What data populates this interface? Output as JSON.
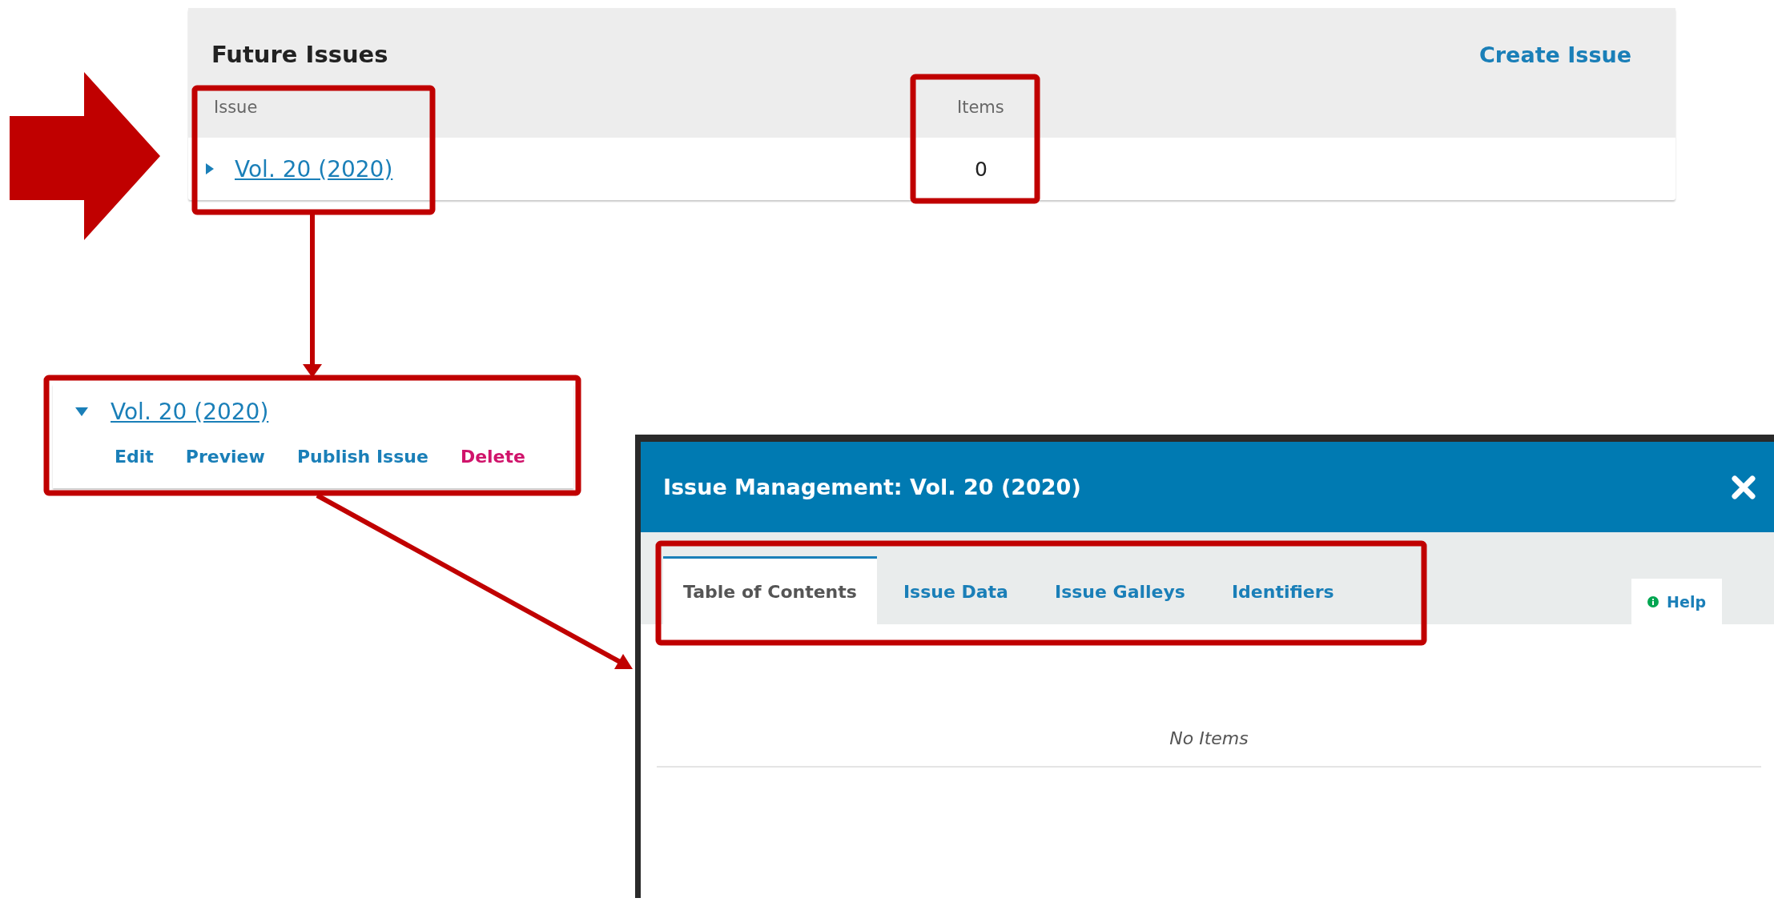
{
  "future_issues": {
    "title": "Future Issues",
    "create_button": "Create Issue",
    "columns": [
      "Issue",
      "Items"
    ],
    "rows": [
      {
        "issue": "Vol. 20 (2020)",
        "items": "0",
        "expanded": false
      }
    ]
  },
  "expanded_issue": {
    "issue": "Vol. 20 (2020)",
    "expanded": true,
    "actions": [
      {
        "label": "Edit",
        "kind": "normal"
      },
      {
        "label": "Preview",
        "kind": "normal"
      },
      {
        "label": "Publish Issue",
        "kind": "normal"
      },
      {
        "label": "Delete",
        "kind": "danger"
      }
    ]
  },
  "modal": {
    "title": "Issue Management: Vol. 20 (2020)",
    "tabs": [
      {
        "label": "Table of Contents",
        "selected": true
      },
      {
        "label": "Issue Data",
        "selected": false
      },
      {
        "label": "Issue Galleys",
        "selected": false
      },
      {
        "label": "Identifiers",
        "selected": false
      }
    ],
    "help": "Help",
    "empty_message": "No Items"
  }
}
